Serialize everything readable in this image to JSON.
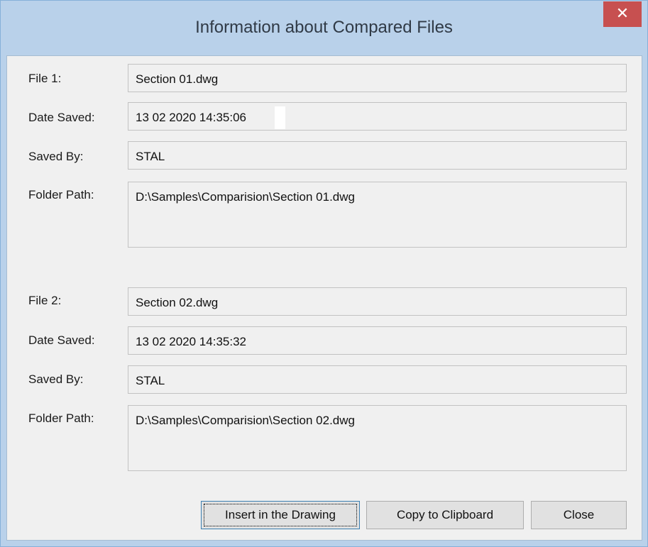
{
  "window": {
    "title": "Information about Compared Files",
    "close_glyph": "✕"
  },
  "file1": {
    "file_label": "File 1:",
    "file_value": "Section 01.dwg",
    "date_label": "Date Saved:",
    "date_value": "13 02 2020  14:35:06",
    "savedby_label": "Saved By:",
    "savedby_value": "STAL",
    "path_label": "Folder Path:",
    "path_value": "D:\\Samples\\Comparision\\Section 01.dwg"
  },
  "file2": {
    "file_label": "File 2:",
    "file_value": "Section 02.dwg",
    "date_label": "Date Saved:",
    "date_value": "13 02 2020   14:35:32",
    "savedby_label": "Saved By:",
    "savedby_value": "STAL",
    "path_label": "Folder Path:",
    "path_value": "D:\\Samples\\Comparision\\Section 02.dwg"
  },
  "buttons": {
    "insert": "Insert in the Drawing",
    "copy": "Copy to Clipboard",
    "close": "Close"
  },
  "colors": {
    "titlebar": "#b9d1ea",
    "close_button": "#c75050",
    "client": "#f0f0f0"
  }
}
